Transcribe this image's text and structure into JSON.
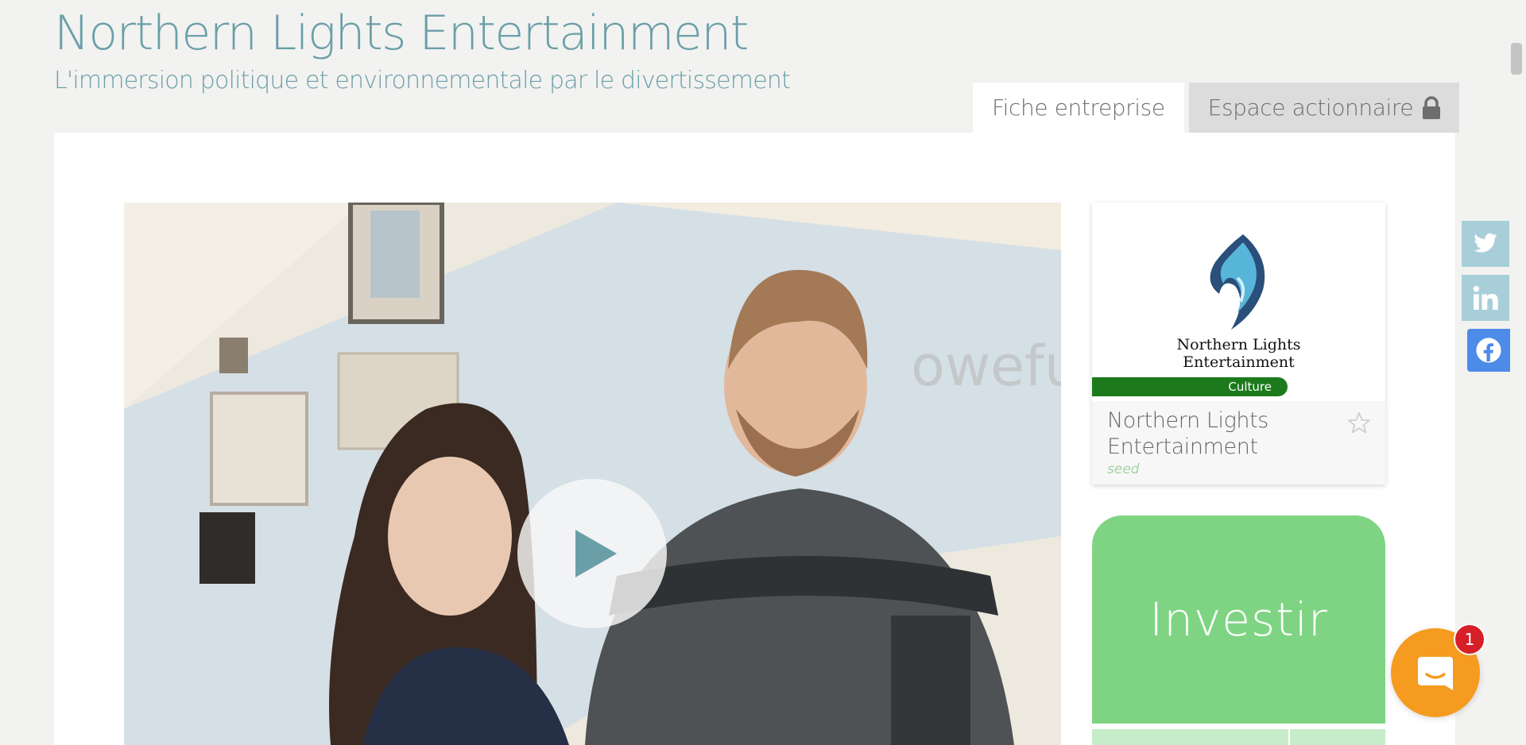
{
  "header": {
    "title": "Northern Lights Entertainment",
    "subtitle": "L'immersion politique et environnementale par le divertissement"
  },
  "tabs": [
    {
      "label": "Fiche entreprise",
      "active": true
    },
    {
      "label": "Espace actionnaire",
      "active": false,
      "icon": "lock-icon"
    }
  ],
  "video": {
    "icon": "play-icon"
  },
  "company_card": {
    "logo_text_line1": "Northern Lights",
    "logo_text_line2": "Entertainment",
    "category": "Culture",
    "name": "Northern Lights Entertainment",
    "stage": "seed",
    "favorite_icon": "star-outline-icon"
  },
  "invest": {
    "label": "Investir"
  },
  "share_buttons": [
    {
      "network": "twitter",
      "icon": "twitter-icon"
    },
    {
      "network": "linkedin",
      "icon": "linkedin-icon"
    },
    {
      "network": "facebook",
      "icon": "facebook-icon"
    }
  ],
  "chat": {
    "unread_count": "1",
    "icon": "chat-icon"
  },
  "colors": {
    "title": "#6a9fa8",
    "invest_green": "#7fd483",
    "category_green": "#1c7a1c",
    "chat_orange": "#f59b1f",
    "badge_red": "#d61f26",
    "facebook_blue": "#4c8be8",
    "share_light_blue": "#a8cfd9"
  }
}
